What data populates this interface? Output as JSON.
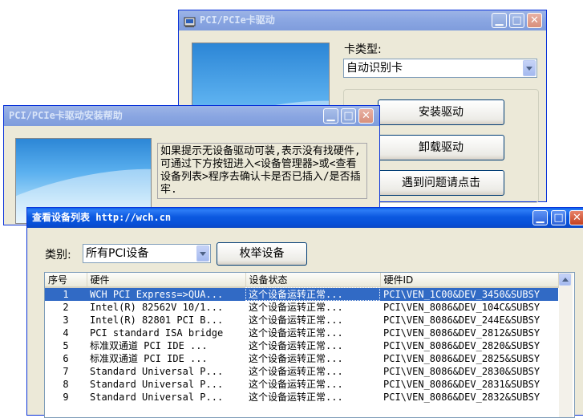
{
  "driver_window": {
    "title": "PCI/PCIe卡驱动",
    "card_type_label": "卡类型:",
    "card_type_value": "自动识别卡",
    "install_button": "安装驱动",
    "uninstall_button": "卸载驱动",
    "help_button": "遇到问题请点击"
  },
  "help_window": {
    "title": "PCI/PCIe卡驱动安装帮助",
    "text": "如果提示无设备驱动可装,表示没有找硬件,可通过下方按钮进入<设备管理器>或<查看设备列表>程序去确认卡是否已插入/是否插牢."
  },
  "device_window": {
    "title": "查看设备列表 http://wch.cn",
    "category_label": "类别:",
    "category_value": "所有PCI设备",
    "enumerate_button": "枚举设备",
    "columns": [
      "序号",
      "硬件",
      "设备状态",
      "硬件ID"
    ],
    "rows": [
      {
        "num": "1",
        "hw": "WCH PCI Express=>QUA...",
        "status": "这个设备运转正常...",
        "id": "PCI\\VEN_1C00&DEV_3450&SUBSY",
        "selected": true
      },
      {
        "num": "2",
        "hw": "Intel(R) 82562V 10/1...",
        "status": "这个设备运转正常...",
        "id": "PCI\\VEN_8086&DEV_104C&SUBSY"
      },
      {
        "num": "3",
        "hw": "Intel(R) 82801 PCI B...",
        "status": "这个设备运转正常...",
        "id": "PCI\\VEN_8086&DEV_244E&SUBSY"
      },
      {
        "num": "4",
        "hw": "PCI standard ISA bridge",
        "status": "这个设备运转正常...",
        "id": "PCI\\VEN_8086&DEV_2812&SUBSY"
      },
      {
        "num": "5",
        "hw": "标准双通道 PCI IDE ...",
        "status": "这个设备运转正常...",
        "id": "PCI\\VEN_8086&DEV_2820&SUBSY"
      },
      {
        "num": "6",
        "hw": "标准双通道 PCI IDE ...",
        "status": "这个设备运转正常...",
        "id": "PCI\\VEN_8086&DEV_2825&SUBSY"
      },
      {
        "num": "7",
        "hw": "Standard Universal P...",
        "status": "这个设备运转正常...",
        "id": "PCI\\VEN_8086&DEV_2830&SUBSY"
      },
      {
        "num": "8",
        "hw": "Standard Universal P...",
        "status": "这个设备运转正常...",
        "id": "PCI\\VEN_8086&DEV_2831&SUBSY"
      },
      {
        "num": "9",
        "hw": "Standard Universal P...",
        "status": "这个设备运转正常...",
        "id": "PCI\\VEN_8086&DEV_2832&SUBSY"
      }
    ]
  },
  "icons": [
    "app-icon",
    "minimize-icon",
    "maximize-icon",
    "close-icon",
    "dropdown-arrow-icon",
    "scroll-up-icon"
  ]
}
